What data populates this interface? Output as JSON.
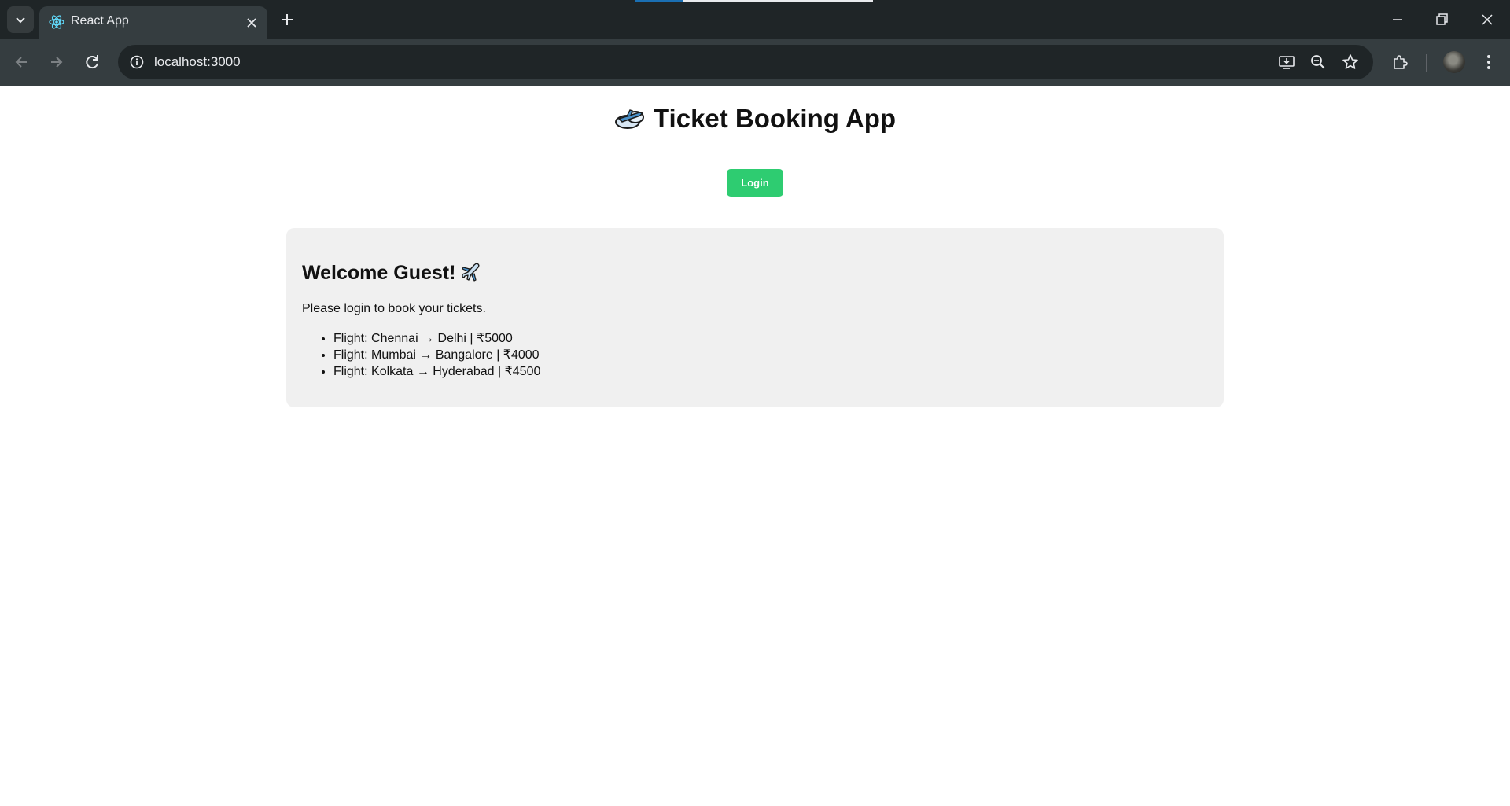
{
  "browser": {
    "tab_title": "React App",
    "url": "localhost:3000"
  },
  "app": {
    "title": "Ticket Booking App",
    "login_label": "Login",
    "accent_color": "#2ecc71"
  },
  "card": {
    "heading": "Welcome Guest!",
    "message": "Please login to book your tickets.",
    "flights": [
      "Flight: Chennai → Delhi | ₹5000",
      "Flight: Mumbai → Bangalore | ₹4000",
      "Flight: Kolkata → Hyderabad | ₹4500"
    ]
  },
  "icons": {
    "title_icon": "plane-and-cloud-icon",
    "heading_icon": "airplane-icon"
  }
}
